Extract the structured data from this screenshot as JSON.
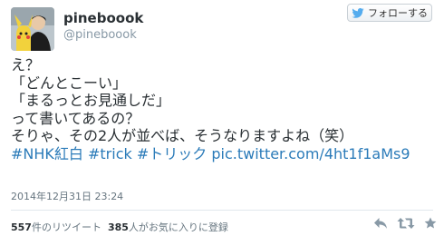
{
  "user": {
    "display_name": "pineboook",
    "handle": "@pineboook"
  },
  "follow_button": {
    "label": "フォローする"
  },
  "tweet": {
    "lines": [
      "え？",
      "「どんとこーい」",
      "「まるっとお見通しだ」",
      "って書いてあるの？",
      "そりゃ、その2人が並べば、そうなりますよね（笑）"
    ],
    "hashtag_1": "#NHK紅白",
    "hashtag_2": "#trick",
    "hashtag_3": "#トリック",
    "media_link": "pic.twitter.com/4ht1f1aMs9",
    "timestamp": "2014年12月31日 23:24"
  },
  "stats": {
    "retweet_count": "557",
    "retweet_label": "件のリツイート",
    "favorite_count": "385",
    "favorite_label": "人がお気に入りに登録"
  },
  "colors": {
    "link": "#2b7bb9",
    "text": "#292f33",
    "muted": "#66757f",
    "bird": "#55acee"
  },
  "icons": [
    "profile-avatar",
    "bird-icon",
    "reply-icon",
    "retweet-icon",
    "favorite-icon"
  ]
}
